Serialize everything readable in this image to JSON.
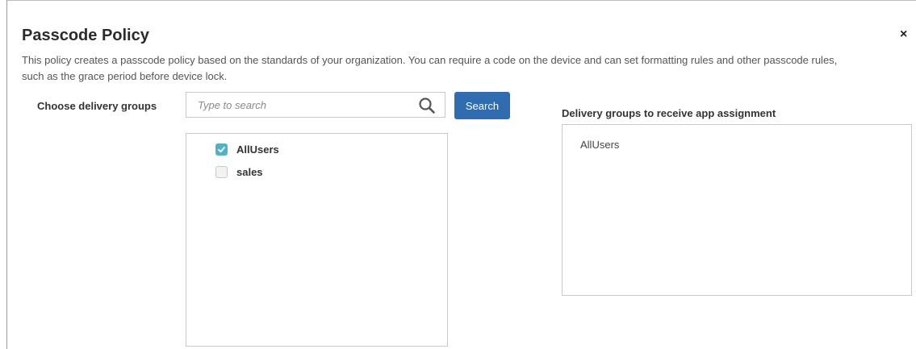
{
  "dialog": {
    "title": "Passcode Policy",
    "description": "This policy creates a passcode policy based on the standards of your organization. You can require a code on the device and can set formatting rules and other passcode rules, such as the grace period before device lock.",
    "close_icon": "close-icon",
    "close_glyph": "×"
  },
  "delivery": {
    "choose_label": "Choose delivery groups",
    "search_placeholder": "Type to search",
    "search_value": "",
    "search_button": "Search",
    "groups": [
      {
        "label": "AllUsers",
        "checked": true
      },
      {
        "label": "sales",
        "checked": false
      }
    ]
  },
  "assignment": {
    "label": "Delivery groups to receive app assignment",
    "items": [
      "AllUsers"
    ]
  },
  "colors": {
    "accent_button": "#2f6db0",
    "checkbox_checked": "#4fb3c8"
  }
}
